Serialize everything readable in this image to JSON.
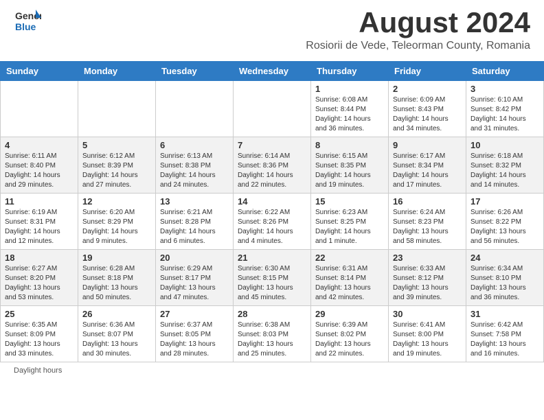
{
  "header": {
    "logo_general": "General",
    "logo_blue": "Blue",
    "month_title": "August 2024",
    "location": "Rosiorii de Vede, Teleorman County, Romania"
  },
  "days_of_week": [
    "Sunday",
    "Monday",
    "Tuesday",
    "Wednesday",
    "Thursday",
    "Friday",
    "Saturday"
  ],
  "footer": {
    "daylight_label": "Daylight hours"
  },
  "weeks": [
    {
      "days": [
        {
          "number": "",
          "info": ""
        },
        {
          "number": "",
          "info": ""
        },
        {
          "number": "",
          "info": ""
        },
        {
          "number": "",
          "info": ""
        },
        {
          "number": "1",
          "info": "Sunrise: 6:08 AM\nSunset: 8:44 PM\nDaylight: 14 hours\nand 36 minutes."
        },
        {
          "number": "2",
          "info": "Sunrise: 6:09 AM\nSunset: 8:43 PM\nDaylight: 14 hours\nand 34 minutes."
        },
        {
          "number": "3",
          "info": "Sunrise: 6:10 AM\nSunset: 8:42 PM\nDaylight: 14 hours\nand 31 minutes."
        }
      ]
    },
    {
      "days": [
        {
          "number": "4",
          "info": "Sunrise: 6:11 AM\nSunset: 8:40 PM\nDaylight: 14 hours\nand 29 minutes."
        },
        {
          "number": "5",
          "info": "Sunrise: 6:12 AM\nSunset: 8:39 PM\nDaylight: 14 hours\nand 27 minutes."
        },
        {
          "number": "6",
          "info": "Sunrise: 6:13 AM\nSunset: 8:38 PM\nDaylight: 14 hours\nand 24 minutes."
        },
        {
          "number": "7",
          "info": "Sunrise: 6:14 AM\nSunset: 8:36 PM\nDaylight: 14 hours\nand 22 minutes."
        },
        {
          "number": "8",
          "info": "Sunrise: 6:15 AM\nSunset: 8:35 PM\nDaylight: 14 hours\nand 19 minutes."
        },
        {
          "number": "9",
          "info": "Sunrise: 6:17 AM\nSunset: 8:34 PM\nDaylight: 14 hours\nand 17 minutes."
        },
        {
          "number": "10",
          "info": "Sunrise: 6:18 AM\nSunset: 8:32 PM\nDaylight: 14 hours\nand 14 minutes."
        }
      ]
    },
    {
      "days": [
        {
          "number": "11",
          "info": "Sunrise: 6:19 AM\nSunset: 8:31 PM\nDaylight: 14 hours\nand 12 minutes."
        },
        {
          "number": "12",
          "info": "Sunrise: 6:20 AM\nSunset: 8:29 PM\nDaylight: 14 hours\nand 9 minutes."
        },
        {
          "number": "13",
          "info": "Sunrise: 6:21 AM\nSunset: 8:28 PM\nDaylight: 14 hours\nand 6 minutes."
        },
        {
          "number": "14",
          "info": "Sunrise: 6:22 AM\nSunset: 8:26 PM\nDaylight: 14 hours\nand 4 minutes."
        },
        {
          "number": "15",
          "info": "Sunrise: 6:23 AM\nSunset: 8:25 PM\nDaylight: 14 hours\nand 1 minute."
        },
        {
          "number": "16",
          "info": "Sunrise: 6:24 AM\nSunset: 8:23 PM\nDaylight: 13 hours\nand 58 minutes."
        },
        {
          "number": "17",
          "info": "Sunrise: 6:26 AM\nSunset: 8:22 PM\nDaylight: 13 hours\nand 56 minutes."
        }
      ]
    },
    {
      "days": [
        {
          "number": "18",
          "info": "Sunrise: 6:27 AM\nSunset: 8:20 PM\nDaylight: 13 hours\nand 53 minutes."
        },
        {
          "number": "19",
          "info": "Sunrise: 6:28 AM\nSunset: 8:18 PM\nDaylight: 13 hours\nand 50 minutes."
        },
        {
          "number": "20",
          "info": "Sunrise: 6:29 AM\nSunset: 8:17 PM\nDaylight: 13 hours\nand 47 minutes."
        },
        {
          "number": "21",
          "info": "Sunrise: 6:30 AM\nSunset: 8:15 PM\nDaylight: 13 hours\nand 45 minutes."
        },
        {
          "number": "22",
          "info": "Sunrise: 6:31 AM\nSunset: 8:14 PM\nDaylight: 13 hours\nand 42 minutes."
        },
        {
          "number": "23",
          "info": "Sunrise: 6:33 AM\nSunset: 8:12 PM\nDaylight: 13 hours\nand 39 minutes."
        },
        {
          "number": "24",
          "info": "Sunrise: 6:34 AM\nSunset: 8:10 PM\nDaylight: 13 hours\nand 36 minutes."
        }
      ]
    },
    {
      "days": [
        {
          "number": "25",
          "info": "Sunrise: 6:35 AM\nSunset: 8:09 PM\nDaylight: 13 hours\nand 33 minutes."
        },
        {
          "number": "26",
          "info": "Sunrise: 6:36 AM\nSunset: 8:07 PM\nDaylight: 13 hours\nand 30 minutes."
        },
        {
          "number": "27",
          "info": "Sunrise: 6:37 AM\nSunset: 8:05 PM\nDaylight: 13 hours\nand 28 minutes."
        },
        {
          "number": "28",
          "info": "Sunrise: 6:38 AM\nSunset: 8:03 PM\nDaylight: 13 hours\nand 25 minutes."
        },
        {
          "number": "29",
          "info": "Sunrise: 6:39 AM\nSunset: 8:02 PM\nDaylight: 13 hours\nand 22 minutes."
        },
        {
          "number": "30",
          "info": "Sunrise: 6:41 AM\nSunset: 8:00 PM\nDaylight: 13 hours\nand 19 minutes."
        },
        {
          "number": "31",
          "info": "Sunrise: 6:42 AM\nSunset: 7:58 PM\nDaylight: 13 hours\nand 16 minutes."
        }
      ]
    }
  ]
}
